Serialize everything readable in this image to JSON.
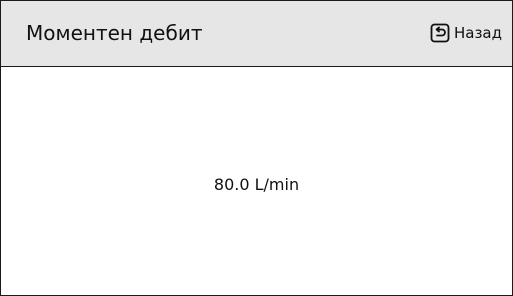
{
  "header": {
    "title": "Моментен дебит",
    "back_label": "Назад",
    "back_icon": "back-return-icon"
  },
  "main": {
    "flow_value": "80.0 L/min"
  },
  "colors": {
    "header_background": "#e6e6e6",
    "border": "#1a1a1a",
    "text": "#111111",
    "background": "#ffffff"
  }
}
